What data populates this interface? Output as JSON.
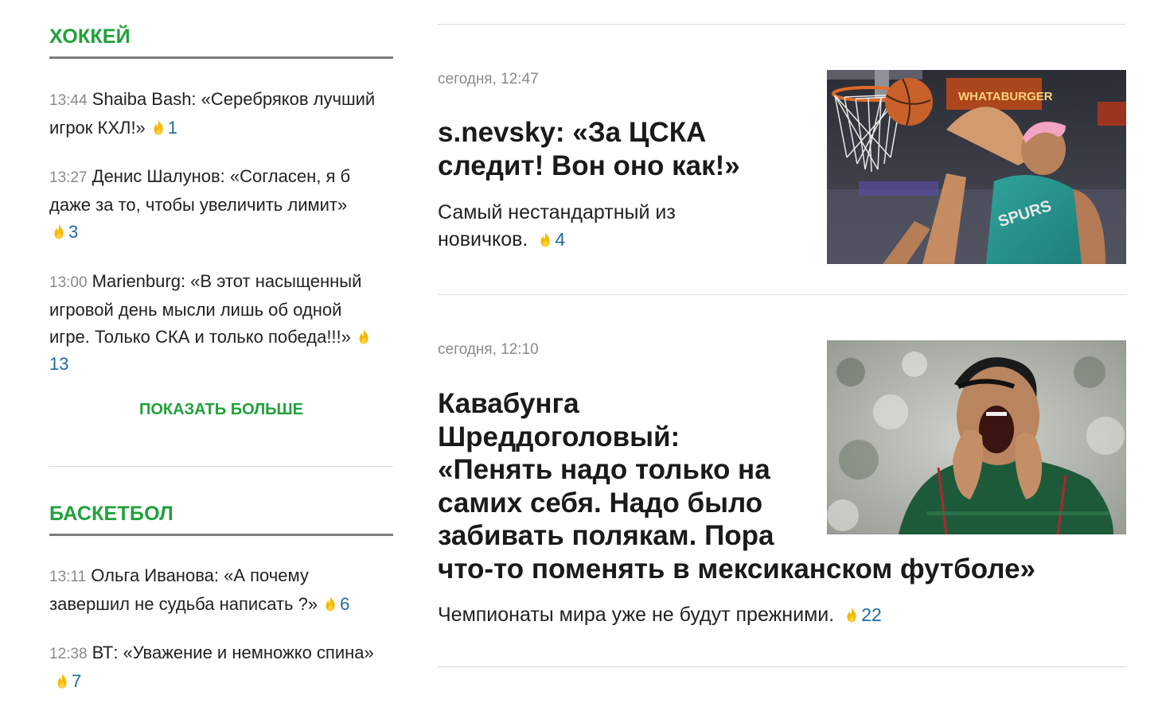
{
  "hockey": {
    "title": "ХОККЕЙ",
    "items": [
      {
        "time": "13:44",
        "text": "Shaiba Bash: «Серебряков лучший игрок КХЛ!»",
        "count": "1"
      },
      {
        "time": "13:27",
        "text": "Денис Шалунов: «Согласен, я б даже за то, чтобы увеличить лимит»",
        "count": "3"
      },
      {
        "time": "13:00",
        "text": "Marienburg: «В этот насыщенный игровой день мысли лишь об одной игре. Только СКА и только победа!!!»",
        "count": "13"
      }
    ],
    "show_more": "ПОКАЗАТЬ БОЛЬШЕ"
  },
  "basketball": {
    "title": "БАСКЕТБОЛ",
    "items": [
      {
        "time": "13:11",
        "text": "Ольга Иванова: «А почему завершил не судьба написать ?»",
        "count": "6"
      },
      {
        "time": "12:38",
        "text": "ВТ: «Уважение и немножко спина»",
        "count": "7"
      }
    ]
  },
  "articles": [
    {
      "time": "сегодня, 12:47",
      "title_lines": [
        "s.nevsky: «За ЦСКА",
        "следит! Вон оно как!»"
      ],
      "subtitle_lines": [
        "Самый нестандартный из",
        "новичков."
      ],
      "count": "4",
      "image": "basketball-dunk-photo",
      "image_text": "SPURS"
    },
    {
      "time": "сегодня, 12:10",
      "title_lines": [
        "Кавабунга",
        "Шреддоголовый:",
        "«Пенять надо только на",
        "самих себя. Надо было",
        "забивать полякам. Пора",
        "что-то поменять в мексиканском футболе»"
      ],
      "subtitle_lines": [
        "Чемпионаты мира уже не будут прежними."
      ],
      "count": "22",
      "image": "football-player-photo"
    }
  ],
  "icons": {
    "reaction": "flame-icon"
  },
  "colors": {
    "section": "#1fa23a",
    "count": "#1f6aa0",
    "flame": "#f5b800",
    "time": "#8a8a8a"
  }
}
